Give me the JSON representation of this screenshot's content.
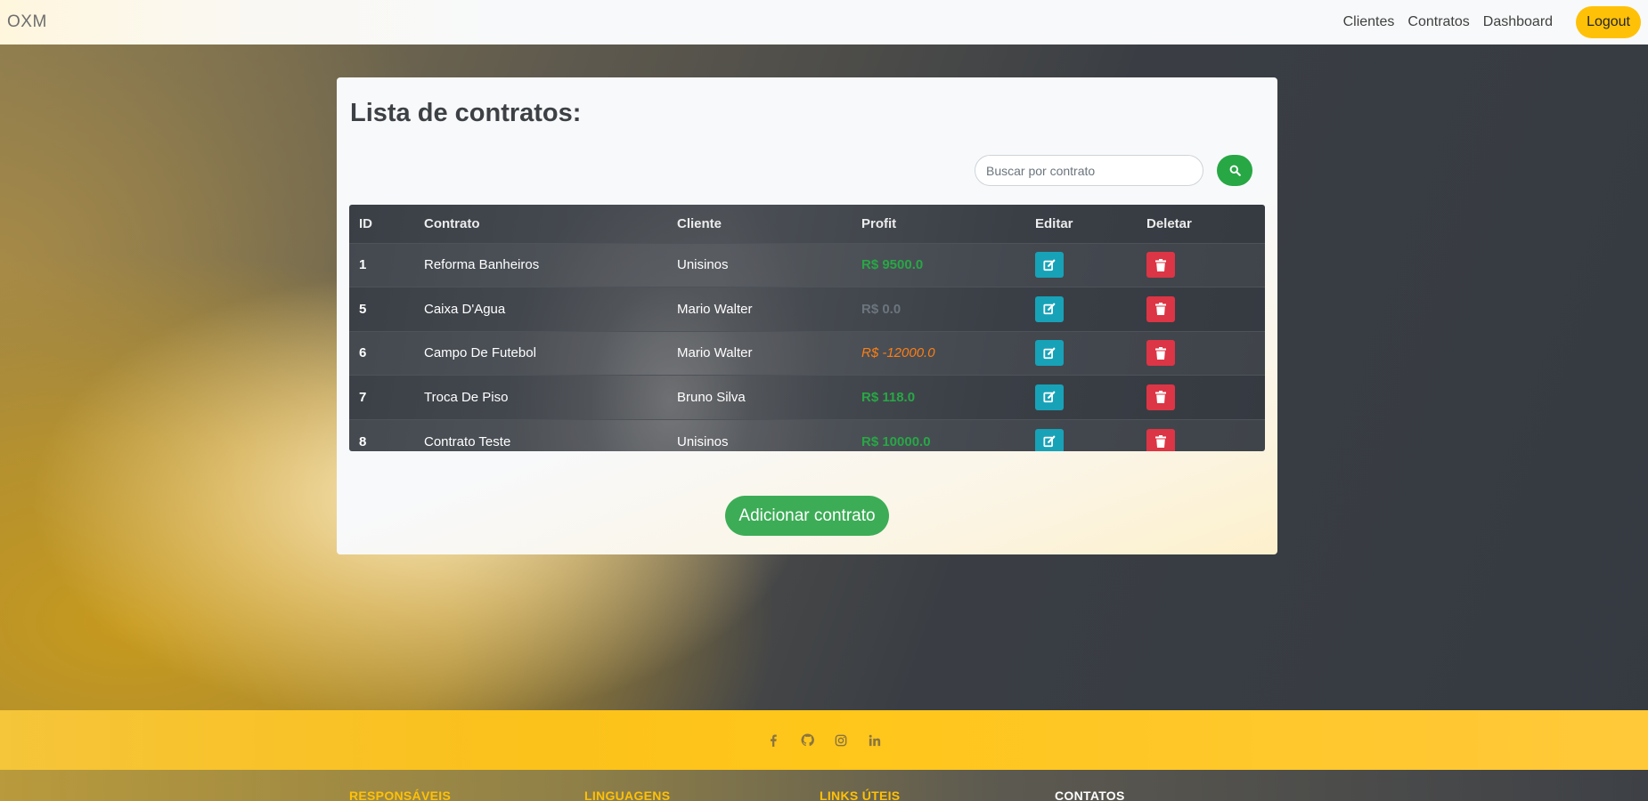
{
  "navbar": {
    "brand": "OXM",
    "links": [
      "Clientes",
      "Contratos",
      "Dashboard"
    ],
    "logout_label": "Logout"
  },
  "card": {
    "title": "Lista de contratos:",
    "search": {
      "placeholder": "Buscar por contrato",
      "value": ""
    },
    "add_button_label": "Adicionar contrato"
  },
  "table": {
    "headers": [
      "ID",
      "Contrato",
      "Cliente",
      "Profit",
      "Editar",
      "Deletar"
    ],
    "rows": [
      {
        "id": "1",
        "contrato": "Reforma Banheiros",
        "cliente": "Unisinos",
        "profit": "R$ 9500.0",
        "profit_status": "positive"
      },
      {
        "id": "5",
        "contrato": "Caixa D'Agua",
        "cliente": "Mario Walter",
        "profit": "R$ 0.0",
        "profit_status": "zero"
      },
      {
        "id": "6",
        "contrato": "Campo De Futebol",
        "cliente": "Mario Walter",
        "profit": "R$ -12000.0",
        "profit_status": "negative"
      },
      {
        "id": "7",
        "contrato": "Troca De Piso",
        "cliente": "Bruno Silva",
        "profit": "R$ 118.0",
        "profit_status": "positive"
      },
      {
        "id": "8",
        "contrato": "Contrato Teste",
        "cliente": "Unisinos",
        "profit": "R$ 10000.0",
        "profit_status": "positive"
      }
    ]
  },
  "footer": {
    "social_icons": [
      "facebook-icon",
      "github-icon",
      "instagram-icon",
      "linkedin-icon"
    ],
    "columns": [
      "RESPONSÁVEIS",
      "LINGUAGENS",
      "LINKS ÚTEIS",
      "CONTATOS"
    ]
  },
  "colors": {
    "accent_yellow": "#ffc107",
    "success_green": "#28a745",
    "edit_blue": "#17a2b8",
    "delete_red": "#dc3545",
    "negative_orange": "#fd7e14"
  }
}
